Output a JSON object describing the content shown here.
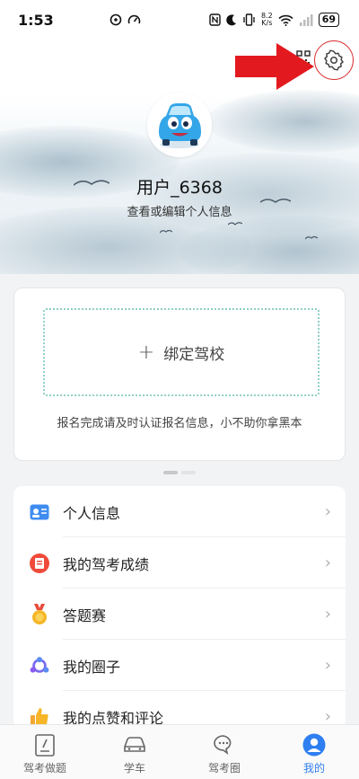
{
  "status_bar": {
    "time": "1:53",
    "net_speed_top": "8.2",
    "net_speed_unit": "K/s",
    "battery": "69"
  },
  "profile": {
    "username": "用户_6368",
    "edit_link": "查看或编辑个人信息"
  },
  "school_card": {
    "bind_label": "绑定驾校",
    "bind_plus": "+",
    "hint": "报名完成请及时认证报名信息，小不助你拿黑本"
  },
  "menu": {
    "items": [
      {
        "label": "个人信息",
        "icon": "id-card-icon",
        "chev": "›"
      },
      {
        "label": "我的驾考成绩",
        "icon": "score-report-icon",
        "chev": "›"
      },
      {
        "label": "答题赛",
        "icon": "medal-icon",
        "chev": "›"
      },
      {
        "label": "我的圈子",
        "icon": "circle-group-icon",
        "chev": "›"
      },
      {
        "label": "我的点赞和评论",
        "icon": "thumbs-up-icon",
        "chev": "›"
      }
    ]
  },
  "tabbar": {
    "tabs": [
      {
        "label": "驾考做题",
        "icon": "exam-doc-icon",
        "active": false
      },
      {
        "label": "学车",
        "icon": "car-icon",
        "active": false
      },
      {
        "label": "驾考圈",
        "icon": "chat-bubbles-icon",
        "active": false
      },
      {
        "label": "我的",
        "icon": "user-icon",
        "active": true
      }
    ]
  },
  "colors": {
    "accent": "#2f7ff0",
    "highlight_red": "#d7282a",
    "dotted_border": "#8fd0c4"
  }
}
